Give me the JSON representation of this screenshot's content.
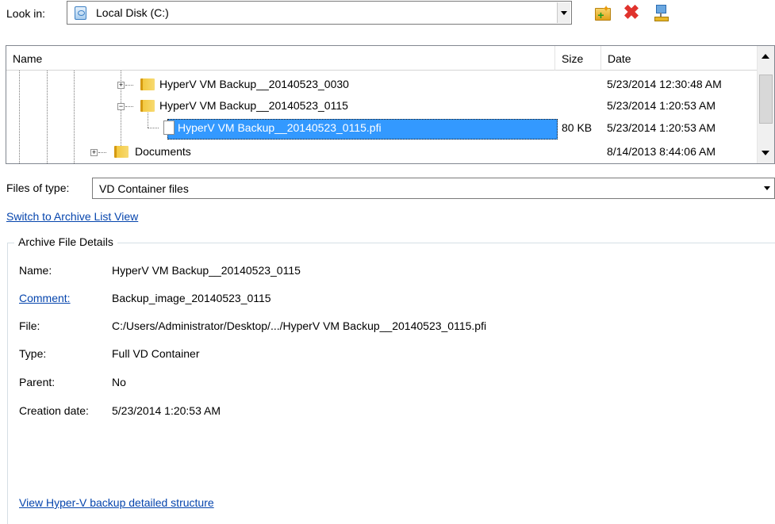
{
  "look_in": {
    "label": "Look in:",
    "value": "Local Disk (C:)",
    "icon": "local-disk-icon"
  },
  "toolbar": {
    "icons": [
      "new-folder-icon",
      "delete-icon",
      "network-icon"
    ]
  },
  "list": {
    "columns": {
      "name": "Name",
      "size": "Size",
      "date": "Date"
    },
    "rows": [
      {
        "name": "HyperV VM Backup__20140523_0030",
        "size": "",
        "date": "5/23/2014 12:30:48 AM",
        "expander": "+",
        "type": "folder"
      },
      {
        "name": "HyperV VM Backup__20140523_0115",
        "size": "",
        "date": "5/23/2014 1:20:53 AM",
        "expander": "−",
        "type": "folder"
      },
      {
        "name": "HyperV VM Backup__20140523_0115.pfi",
        "size": "80 KB",
        "date": "5/23/2014 1:20:53 AM",
        "type": "file",
        "selected": true
      },
      {
        "name": "Documents",
        "size": "",
        "date": "8/14/2013 8:44:06 AM",
        "expander": "+",
        "type": "folder"
      }
    ]
  },
  "files_of_type": {
    "label": "Files of type:",
    "value": "VD Container files"
  },
  "switch_link": "Switch to Archive List View",
  "details": {
    "title": "Archive File Details",
    "name_label": "Name:",
    "name_value": "HyperV VM Backup__20140523_0115",
    "comment_label": "Comment:",
    "comment_value": "Backup_image_20140523_0115",
    "file_label": "File:",
    "file_value": "C:/Users/Administrator/Desktop/.../HyperV VM Backup__20140523_0115.pfi",
    "type_label": "Type:",
    "type_value": "Full VD Container",
    "parent_label": "Parent:",
    "parent_value": "No",
    "creation_label": "Creation date:",
    "creation_value": "5/23/2014 1:20:53 AM"
  },
  "view_link": "View Hyper-V backup detailed structure",
  "colors": {
    "selection": "#3399ff",
    "link": "#0645ad",
    "delete": "#e0332d"
  }
}
